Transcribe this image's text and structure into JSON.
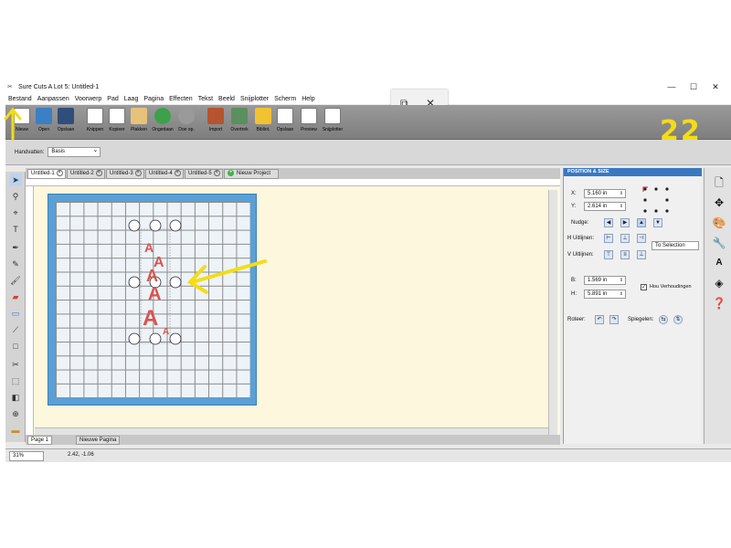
{
  "window": {
    "title": "Sure Cuts A Lot 5: Untitled-1",
    "controls": [
      "—",
      "☐",
      "✕"
    ]
  },
  "menu": [
    "Bestand",
    "Aanpassen",
    "Voorwerp",
    "Pad",
    "Laag",
    "Pagina",
    "Effecten",
    "Tekst",
    "Beeld",
    "Snijplotter",
    "Scherm",
    "Help"
  ],
  "toolbar": [
    "Nieuw",
    "Open",
    "Opslaan",
    "Knippen",
    "Kopieer",
    "Plakken",
    "Ongedaan",
    "Doe op.",
    "Import",
    "Overtrek",
    "Bibliot.",
    "Opslaan",
    "Preview",
    "Snijplotter"
  ],
  "options": {
    "label": "Handvatten:",
    "value": "Basis"
  },
  "tabs": [
    "Untitled-1",
    "Untitled-2",
    "Untitled-3",
    "Untitled-4",
    "Untitled-5",
    "Nieuw Project"
  ],
  "pages": {
    "page": "Page 1",
    "new_page": "Nieuwe Pagina"
  },
  "status": {
    "zoom": "31%",
    "coords": "2.42, -1.06"
  },
  "panel": {
    "title": "POSITION & SIZE",
    "x_label": "X:",
    "x_value": "5.160 in",
    "y_label": "Y:",
    "y_value": "2.614 in",
    "nudge_label": "Nudge:",
    "h_align_label": "H Uitlijnen:",
    "v_align_label": "V Uitlijnen:",
    "align_target": "To Selection",
    "w_label": "B:",
    "w_value": "1.569 in",
    "h_label": "H:",
    "h_value": "5.891 in",
    "keep_ratio": "Hou Verhoudingen",
    "rotate_label": "Roteer:",
    "mirror_label": "Spiegelen:"
  },
  "annotation": {
    "number": "22",
    "arrow_color": "#f3dd15"
  },
  "colors": {
    "mat": "#5aa0d6",
    "canvas": "#fcf7dd",
    "glyph": "#d9534f",
    "panel_header": "#3a78c2"
  }
}
